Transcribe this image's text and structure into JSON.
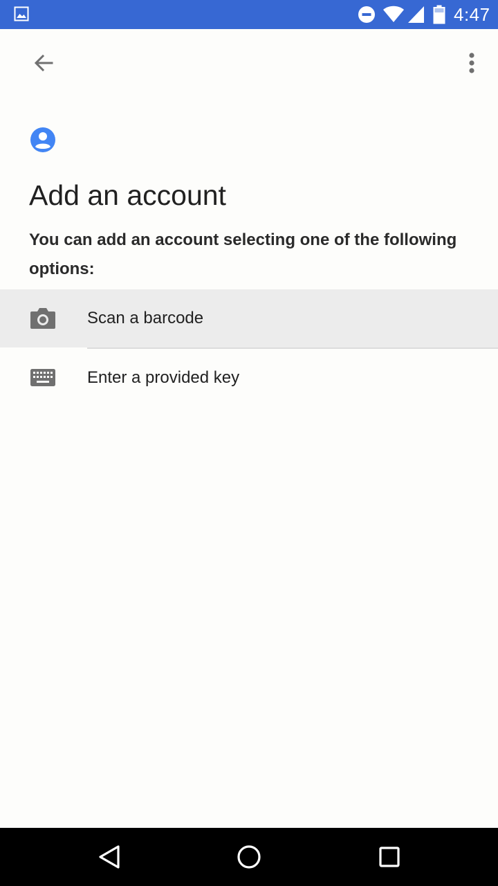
{
  "status_bar": {
    "time": "4:47",
    "color": "#3768d3",
    "icons": [
      "image-icon",
      "do-not-disturb-icon",
      "wifi-icon",
      "signal-icon",
      "battery-icon"
    ]
  },
  "toolbar": {
    "back_icon": "arrow-back-icon",
    "menu_icon": "more-vert-icon"
  },
  "header": {
    "icon": "account-circle-icon",
    "icon_color": "#4285f4",
    "title": "Add an account",
    "description": "You can add an account selecting one of the following options:"
  },
  "options": [
    {
      "label": "Scan a barcode",
      "icon": "camera-icon",
      "selected": true
    },
    {
      "label": "Enter a provided key",
      "icon": "keyboard-icon",
      "selected": false
    }
  ],
  "nav_bar": {
    "buttons": [
      "back-triangle-icon",
      "home-circle-icon",
      "recents-square-icon"
    ]
  }
}
